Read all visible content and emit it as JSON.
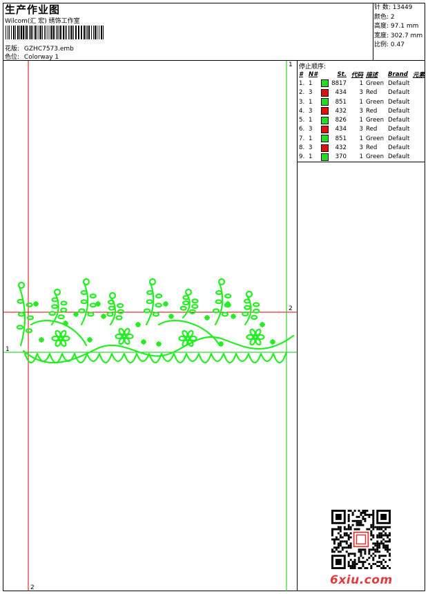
{
  "header": {
    "title": "生产作业图",
    "subtitle": "Wilcom(汇 宏) 绣饰工作室",
    "design_label": "花版:",
    "design_file": "GZHC7573.emb",
    "colorway_label": "色位:",
    "colorway": "Colorway 1"
  },
  "stats": [
    {
      "label": "针 数:",
      "value": "13449"
    },
    {
      "label": "颜色:",
      "value": "2"
    },
    {
      "label": "高度:",
      "value": "97.1 mm"
    },
    {
      "label": "宽度:",
      "value": "302.7 mm"
    },
    {
      "label": "比例:",
      "value": "0.47"
    }
  ],
  "sequence": {
    "heading": "停止顺序:",
    "columns": [
      "#",
      "N#",
      "St.",
      "代码",
      "描述",
      "Brand",
      "元素"
    ],
    "rows": [
      {
        "idx": "1.",
        "n": "1",
        "color": "#22dd22",
        "st": "8817",
        "code": "1",
        "desc": "Green",
        "brand": "Default"
      },
      {
        "idx": "2.",
        "n": "3",
        "color": "#e01010",
        "st": "434",
        "code": "3",
        "desc": "Red",
        "brand": "Default"
      },
      {
        "idx": "3.",
        "n": "1",
        "color": "#22dd22",
        "st": "851",
        "code": "1",
        "desc": "Green",
        "brand": "Default"
      },
      {
        "idx": "4.",
        "n": "3",
        "color": "#e01010",
        "st": "432",
        "code": "3",
        "desc": "Red",
        "brand": "Default"
      },
      {
        "idx": "5.",
        "n": "1",
        "color": "#22dd22",
        "st": "826",
        "code": "1",
        "desc": "Green",
        "brand": "Default"
      },
      {
        "idx": "6.",
        "n": "3",
        "color": "#e01010",
        "st": "434",
        "code": "3",
        "desc": "Red",
        "brand": "Default"
      },
      {
        "idx": "7.",
        "n": "1",
        "color": "#22dd22",
        "st": "851",
        "code": "1",
        "desc": "Green",
        "brand": "Default"
      },
      {
        "idx": "8.",
        "n": "3",
        "color": "#e01010",
        "st": "432",
        "code": "3",
        "desc": "Red",
        "brand": "Default"
      },
      {
        "idx": "9.",
        "n": "1",
        "color": "#22dd22",
        "st": "370",
        "code": "1",
        "desc": "Green",
        "brand": "Default"
      }
    ]
  },
  "guides": {
    "left_v": "2",
    "right_v": "1",
    "top_h": "2",
    "bottom_h": "1"
  },
  "colors": {
    "embroidery": "#22ee22",
    "guide_red": "#e00000",
    "guide_green": "#00cc00"
  },
  "watermark": "6xiu.com"
}
